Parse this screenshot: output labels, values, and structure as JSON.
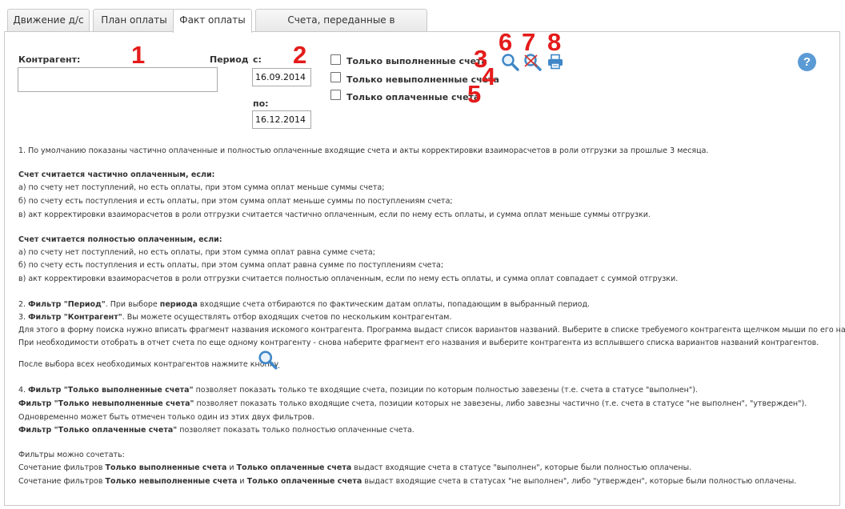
{
  "tabs": [
    {
      "label": "Движение д/с"
    },
    {
      "label": "План оплаты"
    },
    {
      "label": "Факт оплаты"
    },
    {
      "label": "Счета, переданные в бухгалтерию"
    }
  ],
  "filters": {
    "contractor_label": "Контрагент:",
    "period_label": "Период",
    "from_label": "с:",
    "from_value": "16.09.2014",
    "to_label": "по:",
    "to_value": "16.12.2014",
    "checkbox_completed": "Только выполненные счета",
    "checkbox_not_completed": "Только невыполненные счета",
    "checkbox_paid": "Только оплаченные счета"
  },
  "markers": [
    "1",
    "2",
    "3",
    "4",
    "5",
    "6",
    "7",
    "8"
  ],
  "icons": {
    "search": "search-icon",
    "clear": "clear-search-icon",
    "print": "print-icon",
    "help": "help-icon",
    "help_glyph": "?"
  },
  "help_text": {
    "p1": "1. По умолчанию показаны частично оплаченные и полностью оплаченные входящие счета и акты корректировки взаиморасчетов в роли отгрузки за прошлые 3 месяца.",
    "partial_heading": "Счет считается частично оплаченным, если:",
    "partial_a": "а) по счету нет поступлений, но есть оплаты, при этом сумма оплат меньше суммы счета;",
    "partial_b": "б) по счету есть поступления и есть оплаты, при этом сумма оплат меньше суммы по поступлениям счета;",
    "partial_c": "в) акт корректировки взаиморасчетов в роли отгрузки считается частично оплаченным, если по нему есть оплаты, и сумма оплат меньше суммы отгрузки.",
    "full_heading": "Счет считается полностью оплаченным, если:",
    "full_a": "а) по счету нет поступлений, но есть оплаты, при этом сумма оплат равна сумме счета;",
    "full_b": "б) по счету есть поступления и есть оплаты, при этом сумма оплат равна сумме по поступлениям счета;",
    "full_c": "в) акт корректировки взаиморасчетов в роли отгрузки считается полностью оплаченным, если по нему есть оплаты, и сумма оплат совпадает с суммой отгрузки.",
    "p2_prefix": "2. ",
    "p2_bold": "Фильтр \"Период\"",
    "p2_mid": ". При выборе ",
    "p2_bold2": "периода",
    "p2_rest": " входящие счета отбираются по фактическим датам оплаты, попадающим в выбранный период.",
    "p3_prefix": "3. ",
    "p3_bold": "Фильтр \"Контрагент\"",
    "p3_rest": ". Вы можете осуществлять отбор входящих счетов по нескольким контрагентам.",
    "p3_line2": "Для этого в форму поиска нужно вписать фрагмент названия искомого контрагента. Программа выдаст список вариантов названий. Выберите в списке требуемого контрагента щелчком мыши по его названию.",
    "p3_line3": "При необходимости отобрать в отчет счета по еще одному контрагенту - снова наберите фрагмент его названия и выберите контрагента из всплывшего списка вариантов названий контрагентов.",
    "p3_line4": "После выбора всех необходимых контрагентов нажмите кнопку",
    "p3_line4_end": ".",
    "p4_prefix": "4. ",
    "p4_bold": "Фильтр \"Только выполненные счета\"",
    "p4_rest": " позволяет показать только те входящие счета, позиции по которым полностью завезены (т.е. счета в статусе \"выполнен\").",
    "p4b_bold": "Фильтр \"Только невыполненные счета\"",
    "p4b_rest": " позволяет показать только входящие счета, позиции которых не завезены, либо завезны частично (т.е. счета в статусе \"не выполнен\", \"утвержден\").",
    "p4c": "Одновременно может быть отмечен только один из этих двух фильтров.",
    "p4d_bold": "Фильтр \"Только оплаченные счета\"",
    "p4d_rest": " позволяет показать только полностью оплаченные счета.",
    "combo_heading": "Фильтры можно сочетать:",
    "combo1_a": "Сочетание фильтров ",
    "combo1_b1": "Только выполненные счета",
    "combo1_and": " и ",
    "combo1_b2": "Только оплаченные счета",
    "combo1_rest": " выдаст входящие счета в статусе \"выполнен\", которые были полностью оплачены.",
    "combo2_a": "Сочетание фильтров ",
    "combo2_b1": "Только невыполненные счета",
    "combo2_and": " и ",
    "combo2_b2": "Только оплаченные счета",
    "combo2_rest": " выдаст входящие счета в статусах \"не выполнен\", либо \"утвержден\", которые были полностью оплачены."
  },
  "colors": {
    "marker": "#e41b1b",
    "icon_blue": "#3f87c7",
    "help_blue": "#5b9bd5"
  }
}
